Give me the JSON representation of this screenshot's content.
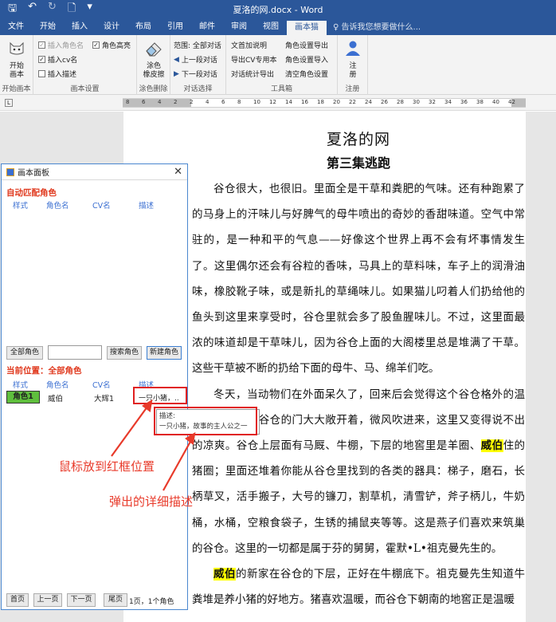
{
  "titlebar": {
    "title": "夏洛的网.docx - Word"
  },
  "menu": {
    "tabs": [
      "文件",
      "开始",
      "插入",
      "设计",
      "布局",
      "引用",
      "邮件",
      "审阅",
      "视图",
      "画本猫"
    ],
    "active": "画本猫",
    "tell": "告诉我您想要做什么..."
  },
  "ribbon": {
    "start": {
      "btn": "开始\n画本",
      "label": "开始画本"
    },
    "settings": {
      "insert_role_name": "插入角色名",
      "insert_cv_name": "插入cv名",
      "insert_desc": "插入描述",
      "role_highlight": "角色高亮",
      "label": "画本设置"
    },
    "eraser": {
      "btn": "涂色\n橡皮擦",
      "label": "涂色删除"
    },
    "dialog": {
      "scope": "范围: 全部对话",
      "prev": "上一段对话",
      "next": "下一段对话",
      "label": "对话选择"
    },
    "tools": {
      "col1": [
        "文首加说明",
        "导出CV专用本",
        "对话统计导出"
      ],
      "col2": [
        "角色设置导出",
        "角色设置导入",
        "清空角色设置"
      ],
      "label": "工具箱"
    },
    "register": {
      "btn": "注\n册",
      "label": "注册"
    }
  },
  "ruler": {
    "ticks": [
      "8",
      "6",
      "4",
      "2",
      "2",
      "4",
      "6",
      "8",
      "10",
      "12",
      "14",
      "16",
      "18",
      "20",
      "22",
      "24",
      "26",
      "28",
      "30",
      "32",
      "34",
      "36",
      "38",
      "40",
      "42"
    ]
  },
  "doc": {
    "title": "夏洛的网",
    "subtitle": "第三集逃跑",
    "p1": "谷仓很大，也很旧。里面全是干草和粪肥的气味。还有种跑累了的马身上的汗味儿与好脾气的母牛喷出的奇妙的香甜味道。空气中常驻的，是一种和平的气息——好像这个世界上再不会有坏事情发生了。这里偶尔还会有谷粒的香味，马具上的草料味，车子上的润滑油味，橡胶靴子味，或是新扎的草绳味儿。如果猫儿叼着人们扔给他的鱼头到这里来享受时，谷仓里就会多了股鱼腥味儿。不过，这里面最浓的味道却是干草味儿，因为谷仓上面的大阁楼里总是堆满了干草。这些干草被不断的扔给下面的母牛、马、绵羊们吃。",
    "p2_a": "冬天，当动物们在外面呆久了，回来后会觉得这个谷仓格外的温暖。夏天，当谷仓的门大大敞开着，微风吹进来，这里又变得说不出的凉爽。谷仓上层面有马厩、牛棚，下层的地窖里是羊圈、",
    "p2_hl": "威伯",
    "p2_b": "住的猪圈；里面还堆着你能从谷仓里找到的各类的器具：梯子，磨石，长柄草叉，活手搬子，大号的镰刀，割草机，清雪铲，斧子柄儿，牛奶桶，水桶，空粮食袋子，生锈的捕鼠夹等等。这是燕子们喜欢来筑巢的谷仓。这里的一切都是属于芬的舅舅，霍默•L•祖克曼先生的。",
    "p3_hl": "威伯",
    "p3_b": "的新家在谷仓的下层，正好在牛棚底下。祖克曼先生知道牛粪堆是养小猪的好地方。猪喜欢温暖，而谷仓下朝南的地窖正是温暖"
  },
  "panel": {
    "title": "画本面板",
    "auto_title": "自动匹配角色",
    "headers": [
      "样式",
      "角色名",
      "CV名",
      "描述"
    ],
    "btn_all": "全部角色",
    "btn_search": "搜索角色",
    "btn_new": "新建角色",
    "current": "当前位置：全部角色",
    "row": {
      "style": "角色1",
      "name": "威伯",
      "cv": "大辉1",
      "desc": "一只小猪，.."
    },
    "tooltip_label": "描述:",
    "tooltip_text": "一只小猪，故事的主人公之一",
    "pager": [
      "首页",
      "上一页",
      "下一页",
      "尾页"
    ],
    "page_info": "1页，1个角色"
  },
  "annotations": {
    "mouse": "鼠标放到红框位置",
    "popup": "弹出的详细描述"
  },
  "colors": {
    "word_blue": "#2b579a",
    "accent_red": "#e02020",
    "highlight": "#ffff00",
    "role_green": "#5fbf3d"
  }
}
